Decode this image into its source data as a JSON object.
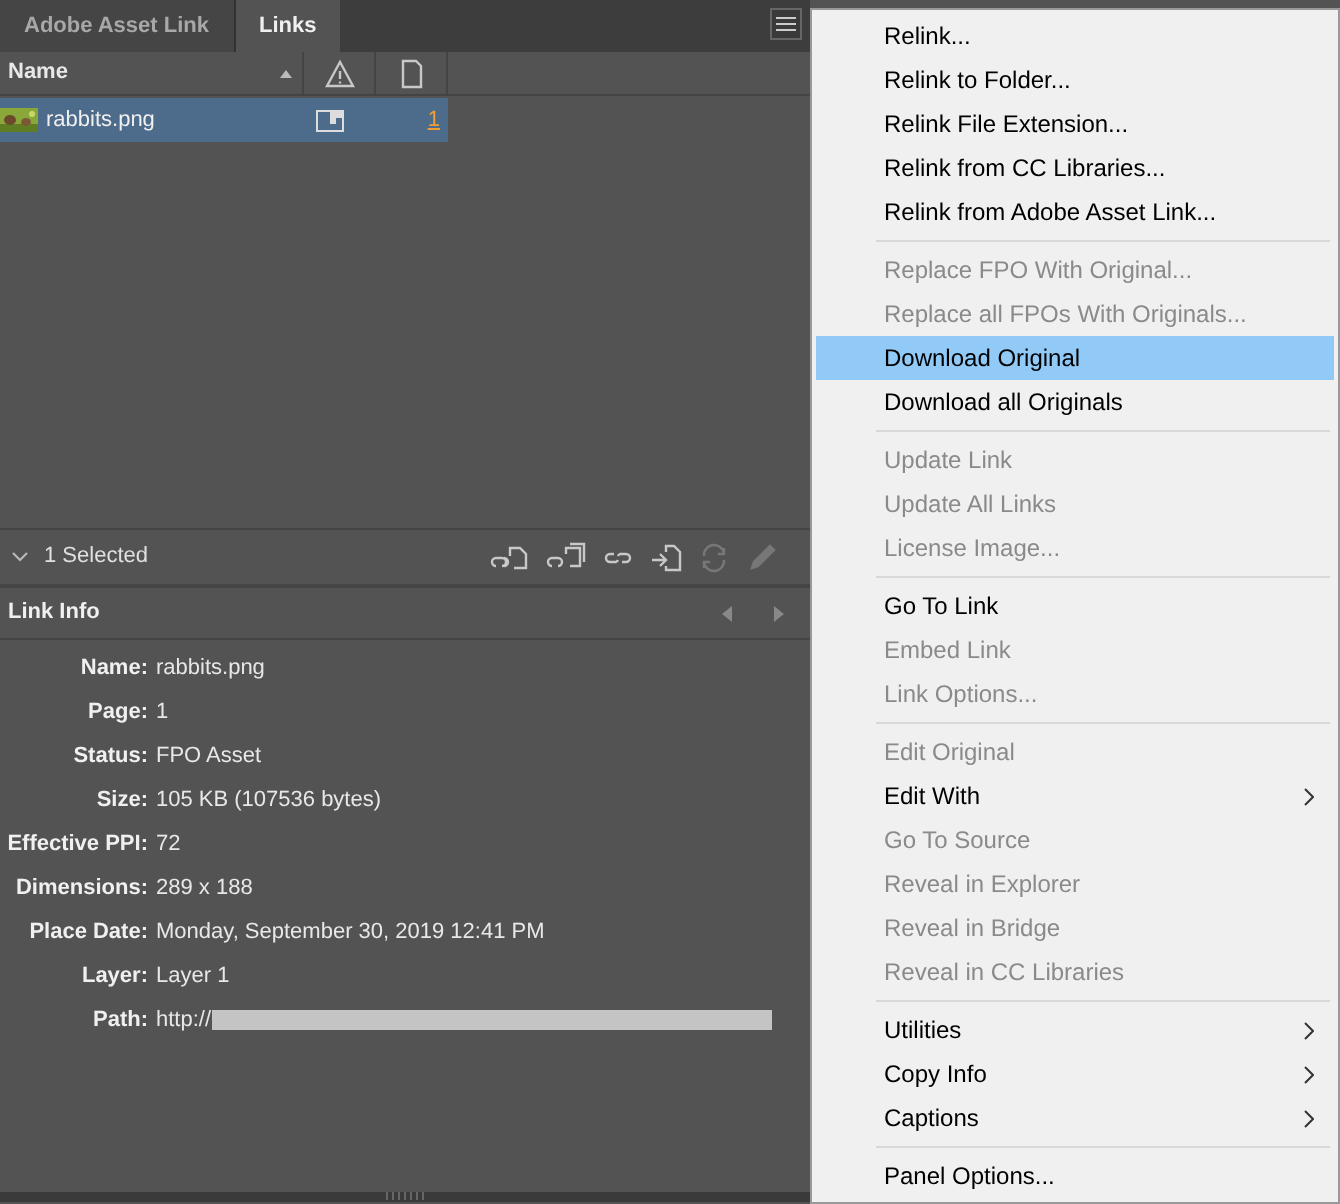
{
  "tabs": [
    {
      "label": "Adobe Asset Link",
      "selected": false
    },
    {
      "label": "Links",
      "selected": true
    }
  ],
  "table": {
    "columns": [
      {
        "kind": "text",
        "label": "Name"
      },
      {
        "kind": "warning"
      },
      {
        "kind": "page"
      }
    ],
    "rows": [
      {
        "name": "rabbits.png",
        "page": "1",
        "selected": true
      }
    ]
  },
  "selection": {
    "count": "1 Selected"
  },
  "link_info": {
    "title": "Link Info",
    "fields": [
      {
        "label": "Name:",
        "value": "rabbits.png"
      },
      {
        "label": "Page:",
        "value": "1"
      },
      {
        "label": "Status:",
        "value": "FPO Asset"
      },
      {
        "label": "Size:",
        "value": "105 KB (107536 bytes)"
      },
      {
        "label": "Effective PPI:",
        "value": "72"
      },
      {
        "label": "Dimensions:",
        "value": "289 x 188"
      },
      {
        "label": "Place Date:",
        "value": "Monday, September 30, 2019 12:41 PM"
      },
      {
        "label": "Layer:",
        "value": "Layer 1"
      },
      {
        "label": "Path:",
        "value": "http://",
        "redacted": true
      }
    ]
  },
  "menu": [
    {
      "kind": "item",
      "label": "Relink...",
      "disabled": false,
      "selected": false,
      "submenu": false
    },
    {
      "kind": "item",
      "label": "Relink to Folder...",
      "disabled": false,
      "selected": false,
      "submenu": false
    },
    {
      "kind": "item",
      "label": "Relink File Extension...",
      "disabled": false,
      "selected": false,
      "submenu": false
    },
    {
      "kind": "item",
      "label": "Relink from CC Libraries...",
      "disabled": false,
      "selected": false,
      "submenu": false
    },
    {
      "kind": "item",
      "label": "Relink from Adobe Asset Link...",
      "disabled": false,
      "selected": false,
      "submenu": false
    },
    {
      "kind": "separator"
    },
    {
      "kind": "item",
      "label": "Replace FPO With Original...",
      "disabled": true,
      "selected": false,
      "submenu": false
    },
    {
      "kind": "item",
      "label": "Replace all FPOs With Originals...",
      "disabled": true,
      "selected": false,
      "submenu": false
    },
    {
      "kind": "item",
      "label": "Download Original",
      "disabled": false,
      "selected": true,
      "submenu": false
    },
    {
      "kind": "item",
      "label": "Download all Originals",
      "disabled": false,
      "selected": false,
      "submenu": false
    },
    {
      "kind": "separator"
    },
    {
      "kind": "item",
      "label": "Update Link",
      "disabled": true,
      "selected": false,
      "submenu": false
    },
    {
      "kind": "item",
      "label": "Update All Links",
      "disabled": true,
      "selected": false,
      "submenu": false
    },
    {
      "kind": "item",
      "label": "License Image...",
      "disabled": true,
      "selected": false,
      "submenu": false
    },
    {
      "kind": "separator"
    },
    {
      "kind": "item",
      "label": "Go To Link",
      "disabled": false,
      "selected": false,
      "submenu": false
    },
    {
      "kind": "item",
      "label": "Embed Link",
      "disabled": true,
      "selected": false,
      "submenu": false
    },
    {
      "kind": "item",
      "label": "Link Options...",
      "disabled": true,
      "selected": false,
      "submenu": false
    },
    {
      "kind": "separator"
    },
    {
      "kind": "item",
      "label": "Edit Original",
      "disabled": true,
      "selected": false,
      "submenu": false
    },
    {
      "kind": "item",
      "label": "Edit With",
      "disabled": false,
      "selected": false,
      "submenu": true
    },
    {
      "kind": "item",
      "label": "Go To Source",
      "disabled": true,
      "selected": false,
      "submenu": false
    },
    {
      "kind": "item",
      "label": "Reveal in Explorer",
      "disabled": true,
      "selected": false,
      "submenu": false
    },
    {
      "kind": "item",
      "label": "Reveal in Bridge",
      "disabled": true,
      "selected": false,
      "submenu": false
    },
    {
      "kind": "item",
      "label": "Reveal in CC Libraries",
      "disabled": true,
      "selected": false,
      "submenu": false
    },
    {
      "kind": "separator"
    },
    {
      "kind": "item",
      "label": "Utilities",
      "disabled": false,
      "selected": false,
      "submenu": true
    },
    {
      "kind": "item",
      "label": "Copy Info",
      "disabled": false,
      "selected": false,
      "submenu": true
    },
    {
      "kind": "item",
      "label": "Captions",
      "disabled": false,
      "selected": false,
      "submenu": true
    },
    {
      "kind": "separator"
    },
    {
      "kind": "item",
      "label": "Panel Options...",
      "disabled": false,
      "selected": false,
      "submenu": false
    }
  ]
}
